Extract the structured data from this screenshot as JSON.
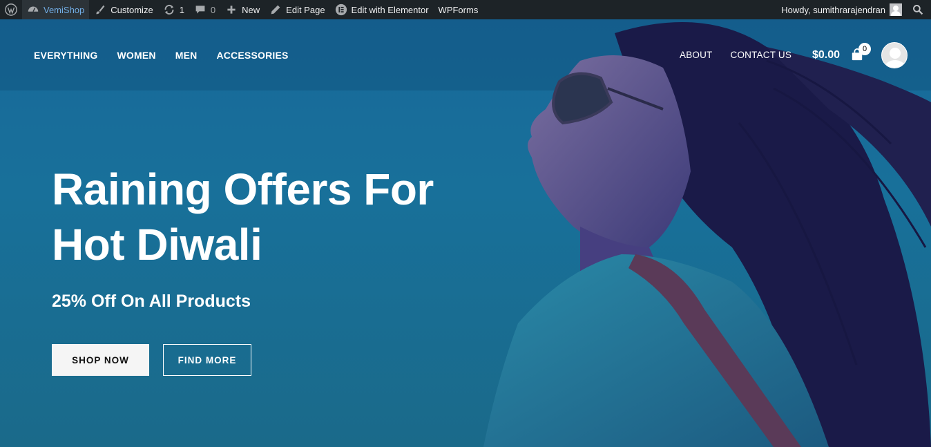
{
  "adminbar": {
    "wp_logo_icon": "wordpress-icon",
    "site_name": "VemiShop",
    "customize": "Customize",
    "updates_count": "1",
    "comments_count": "0",
    "new": "New",
    "edit_page": "Edit Page",
    "edit_elementor": "Edit with Elementor",
    "wpforms": "WPForms",
    "howdy": "Howdy, sumithrarajendran"
  },
  "nav": {
    "left": [
      "EVERYTHING",
      "WOMEN",
      "MEN",
      "ACCESSORIES"
    ],
    "right": [
      "ABOUT",
      "CONTACT US"
    ]
  },
  "cart": {
    "total": "$0.00",
    "count": "0"
  },
  "hero": {
    "headline_line1": "Raining Offers For",
    "headline_line2": "Hot Diwali",
    "subline": "25% Off On All Products",
    "shop_now": "SHOP NOW",
    "find_more": "FIND MORE"
  },
  "colors": {
    "adminbar_bg": "#1d2327",
    "hero_bg": "#17699a",
    "accent_link": "#72aee6"
  }
}
